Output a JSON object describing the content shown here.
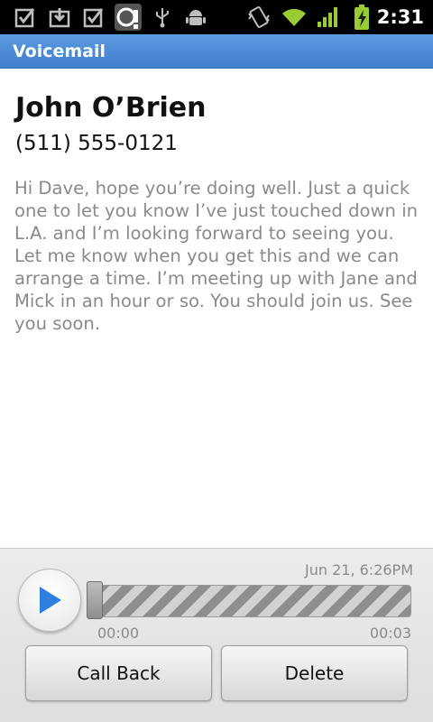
{
  "status_bar": {
    "time": "2:31",
    "icons": [
      "checkbox-icon",
      "download-icon",
      "checkbox-icon",
      "voicemail-alert-icon",
      "usb-icon",
      "android-debug-icon",
      "vibrate-icon",
      "wifi-icon",
      "signal-icon",
      "battery-charging-icon"
    ]
  },
  "app": {
    "title": "Voicemail"
  },
  "contact": {
    "name": "John O’Brien",
    "phone": "(511) 555-0121"
  },
  "message": {
    "text": "Hi Dave, hope you’re doing well. Just a quick one to let you know I’ve just touched down in L.A. and I’m looking forward to seeing you. Let me know when you get this and we can arrange a time. I’m meeting up with Jane and Mick in an hour or so. You should join us. See you soon."
  },
  "player": {
    "timestamp": "Jun 21, 6:26PM",
    "current_time": "00:00",
    "duration": "00:03",
    "progress": 0
  },
  "actions": {
    "call_back_label": "Call Back",
    "delete_label": "Delete"
  },
  "colors": {
    "accent": "#3f7fcd",
    "play_icon": "#2f7fe0"
  }
}
